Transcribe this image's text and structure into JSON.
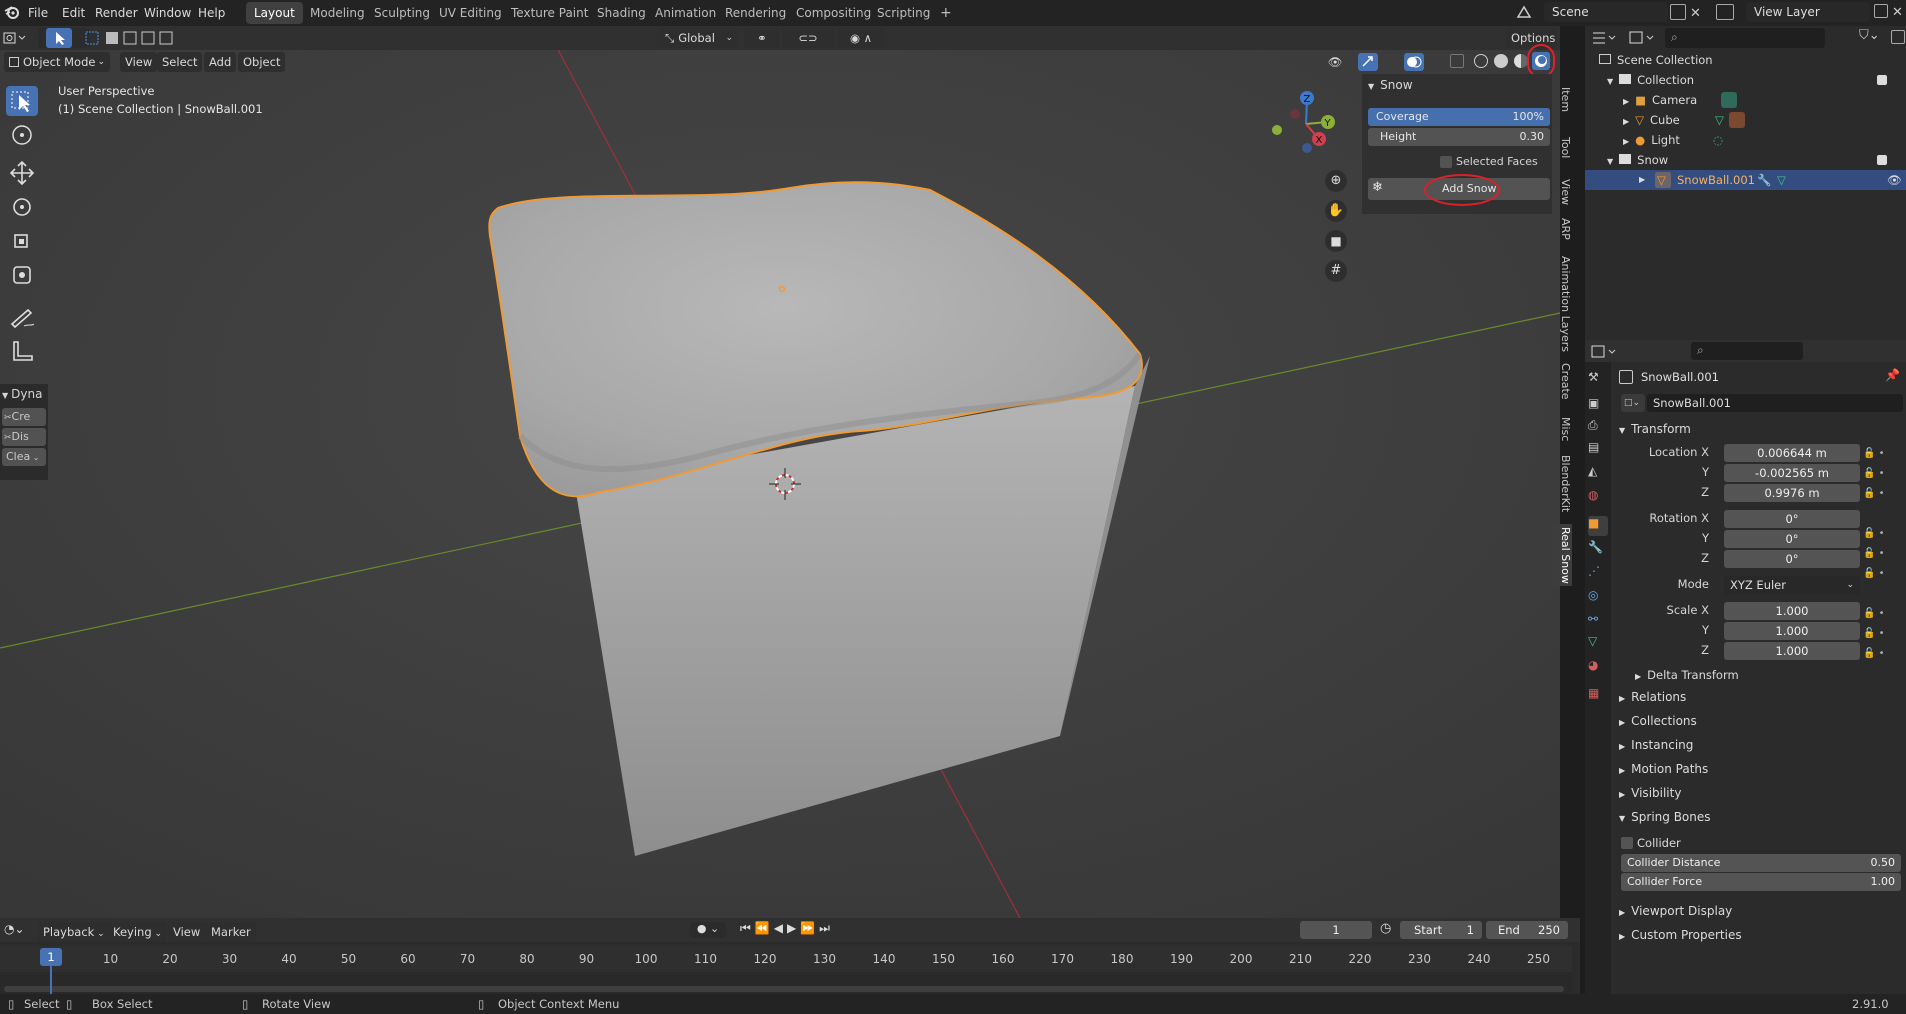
{
  "topbar": {
    "menus": [
      "File",
      "Edit",
      "Render",
      "Window",
      "Help"
    ],
    "workspaces": [
      "Layout",
      "Modeling",
      "Sculpting",
      "UV Editing",
      "Texture Paint",
      "Shading",
      "Animation",
      "Rendering",
      "Compositing",
      "Scripting"
    ],
    "active_workspace": "Layout",
    "add_tab": "+",
    "scene": "Scene",
    "view_layer": "View Layer"
  },
  "viewport_header": {
    "mode": "Object Mode",
    "menus": [
      "View",
      "Select",
      "Add",
      "Object"
    ],
    "orientation": "Global",
    "options": "Options"
  },
  "viewport_info": {
    "line1": "User Perspective",
    "line2": "(1) Scene Collection | SnowBall.001"
  },
  "gizmo": {
    "z": "Z",
    "y": "Y",
    "x": "X"
  },
  "dyna_panel": {
    "title": "Dyna",
    "items": [
      "Cre",
      "Dis",
      "Clea"
    ]
  },
  "snow_panel": {
    "title": "Snow",
    "coverage_label": "Coverage",
    "coverage_value": "100%",
    "coverage_fraction": 1.0,
    "height_label": "Height",
    "height_value": "0.30",
    "selected_faces": "Selected Faces",
    "add_snow": "Add Snow"
  },
  "side_tabs": [
    "Item",
    "Tool",
    "View",
    "ARP",
    "Animation Layers",
    "Create",
    "Misc",
    "BlenderKit",
    "Real Snow"
  ],
  "outliner": {
    "scene_collection": "Scene Collection",
    "rows": [
      {
        "label": "Collection",
        "kind": "collection"
      },
      {
        "label": "Camera",
        "kind": "camera"
      },
      {
        "label": "Cube",
        "kind": "mesh"
      },
      {
        "label": "Light",
        "kind": "light"
      },
      {
        "label": "Snow",
        "kind": "collection"
      },
      {
        "label": "SnowBall.001",
        "kind": "mesh",
        "selected": true
      }
    ]
  },
  "properties": {
    "object_name": "SnowBall.001",
    "object_field": "SnowBall.001",
    "transform": "Transform",
    "location_label": "Location X",
    "location": [
      "0.006644 m",
      "-0.002565 m",
      "0.9976 m"
    ],
    "rotation_label": "Rotation X",
    "rotation": [
      "0°",
      "0°",
      "0°"
    ],
    "mode_label": "Mode",
    "mode_value": "XYZ Euler",
    "scale_label": "Scale X",
    "scale": [
      "1.000",
      "1.000",
      "1.000"
    ],
    "y": "Y",
    "z": "Z",
    "delta_transform": "Delta Transform",
    "sections": [
      "Relations",
      "Collections",
      "Instancing",
      "Motion Paths",
      "Visibility"
    ],
    "spring_bones": "Spring Bones",
    "collider": "Collider",
    "collider_distance_label": "Collider Distance",
    "collider_distance": "0.50",
    "collider_force_label": "Collider Force",
    "collider_force": "1.00",
    "sections2": [
      "Viewport Display",
      "Custom Properties"
    ]
  },
  "timeline": {
    "menus": [
      "Playback",
      "Keying",
      "View",
      "Marker"
    ],
    "current_frame": "1",
    "start_label": "Start",
    "start": "1",
    "end_label": "End",
    "end": "250",
    "ticks": [
      "1",
      "10",
      "20",
      "30",
      "40",
      "50",
      "60",
      "70",
      "80",
      "90",
      "100",
      "110",
      "120",
      "130",
      "140",
      "150",
      "160",
      "170",
      "180",
      "190",
      "200",
      "210",
      "220",
      "230",
      "240",
      "250"
    ]
  },
  "statusbar": {
    "select": "Select",
    "box_select": "Box Select",
    "rotate_view": "Rotate View",
    "context_menu": "Object Context Menu",
    "version": "2.91.0"
  },
  "colors": {
    "accent_blue": "#4772b3",
    "selection_orange": "#f09a36",
    "annotation_red": "#e0202a",
    "axis_red": "#a0303a",
    "axis_green": "#6a8a2a"
  }
}
